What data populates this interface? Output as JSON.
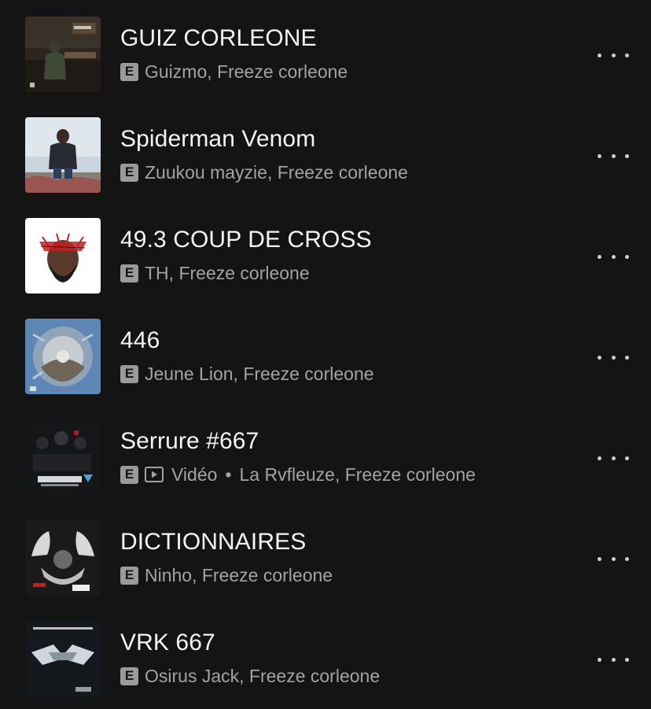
{
  "tracks": [
    {
      "title": "GUIZ CORLEONE",
      "artists": "Guizmo, Freeze corleone",
      "explicit": "E",
      "artwork": "guiz-artwork",
      "more_icon": "ellipsis-icon"
    },
    {
      "title": "Spiderman Venom",
      "artists": "Zuukou mayzie, Freeze corleone",
      "explicit": "E",
      "artwork": "spiderman-artwork",
      "more_icon": "ellipsis-icon"
    },
    {
      "title": "49.3 COUP DE CROSS",
      "artists": "TH, Freeze corleone",
      "explicit": "E",
      "artwork": "coup-de-cross-artwork",
      "more_icon": "ellipsis-icon"
    },
    {
      "title": "446",
      "artists": "Jeune Lion, Freeze corleone",
      "explicit": "E",
      "artwork": "446-artwork",
      "more_icon": "ellipsis-icon"
    },
    {
      "title": "Serrure #667",
      "video_label": "Vidéo",
      "separator": "•",
      "artists": "La Rvfleuze, Freeze corleone",
      "explicit": "E",
      "artwork": "serrure-artwork",
      "more_icon": "ellipsis-icon"
    },
    {
      "title": "DICTIONNAIRES",
      "artists": "Ninho, Freeze corleone",
      "explicit": "E",
      "artwork": "dictionnaires-artwork",
      "more_icon": "ellipsis-icon"
    },
    {
      "title": "VRK 667",
      "artists": "Osirus Jack, Freeze corleone",
      "explicit": "E",
      "artwork": "vrk-artwork",
      "more_icon": "ellipsis-icon"
    }
  ],
  "colors": {
    "background": "#141414",
    "title": "#f4f4f4",
    "subtitle": "#a3a3a3",
    "badge": "#9a9a9a"
  }
}
